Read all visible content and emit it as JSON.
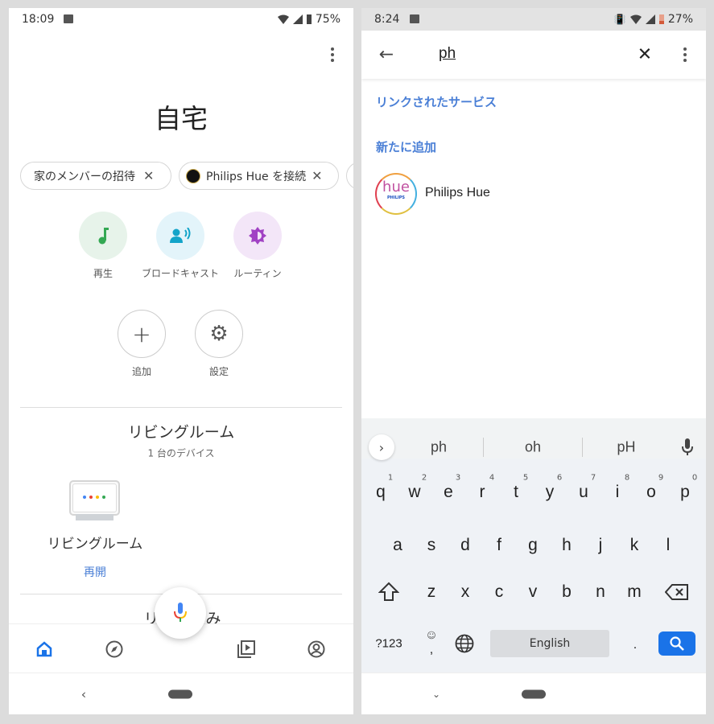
{
  "left": {
    "status": {
      "time": "18:09",
      "battery": "75%"
    },
    "title": "自宅",
    "chips": [
      {
        "label": "家のメンバーの招待"
      },
      {
        "label": "Philips Hue を接続"
      }
    ],
    "actions": [
      {
        "label": "再生",
        "icon": "music-note-icon",
        "bg": "#e7f3ea",
        "color": "#34a853"
      },
      {
        "label": "ブロードキャスト",
        "icon": "broadcast-icon",
        "bg": "#e3f4fa",
        "color": "#12a4c9"
      },
      {
        "label": "ルーティン",
        "icon": "routine-icon",
        "bg": "#f3e6f8",
        "color": "#a142c4"
      }
    ],
    "secondary_actions": [
      {
        "label": "追加",
        "icon": "plus-icon"
      },
      {
        "label": "設定",
        "icon": "gear-icon"
      }
    ],
    "room": {
      "title": "リビングルーム",
      "subtitle": "1 台のデバイス",
      "device_name": "リビングルーム",
      "device_action": "再開"
    },
    "next_room_partial": {
      "start": "リ",
      "end": "み"
    },
    "bottom_nav": [
      "home-icon",
      "explore-icon",
      "media-icon",
      "account-icon"
    ],
    "accent": "#1a73e8"
  },
  "right": {
    "status": {
      "time": "8:24",
      "battery": "27%"
    },
    "search": {
      "value": "ph"
    },
    "sections": {
      "linked": "リンクされたサービス",
      "add_new": "新たに追加"
    },
    "result": {
      "name": "Philips Hue",
      "logo_text": "hue",
      "logo_sub": "PHILIPS"
    },
    "keyboard": {
      "suggestions": [
        "ph",
        "oh",
        "pH"
      ],
      "row1": [
        "q",
        "w",
        "e",
        "r",
        "t",
        "y",
        "u",
        "i",
        "o",
        "p"
      ],
      "row1_hints": [
        "1",
        "2",
        "3",
        "4",
        "5",
        "6",
        "7",
        "8",
        "9",
        "0"
      ],
      "row2": [
        "a",
        "s",
        "d",
        "f",
        "g",
        "h",
        "j",
        "k",
        "l"
      ],
      "row3": [
        "z",
        "x",
        "c",
        "v",
        "b",
        "n",
        "m"
      ],
      "symbols": "?123",
      "comma": ",",
      "space": "English",
      "period": ".",
      "search_color": "#1a73e8"
    }
  }
}
